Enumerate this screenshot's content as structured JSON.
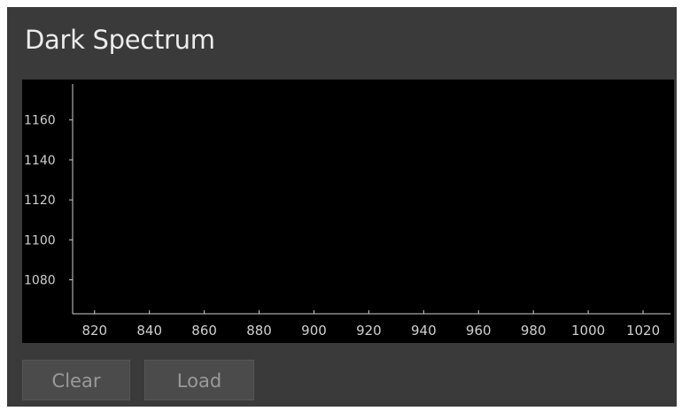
{
  "panel": {
    "title": "Dark Spectrum"
  },
  "buttons": {
    "clear_label": "Clear",
    "load_label": "Load"
  },
  "colors": {
    "panel_bg": "#3a3a3a",
    "plot_bg": "#000000",
    "axis": "#cfcfcf",
    "tick_text": "#cfcfcf",
    "button_bg": "#4b4b4b",
    "button_text": "#9a9a9a"
  },
  "chart_data": {
    "type": "line",
    "series": [],
    "x_ticks": [
      820,
      840,
      860,
      880,
      900,
      920,
      940,
      960,
      980,
      1000,
      1020
    ],
    "y_ticks": [
      1080,
      1100,
      1120,
      1140,
      1160
    ],
    "xlim": [
      812,
      1030
    ],
    "ylim": [
      1063,
      1178
    ],
    "grid": false
  }
}
